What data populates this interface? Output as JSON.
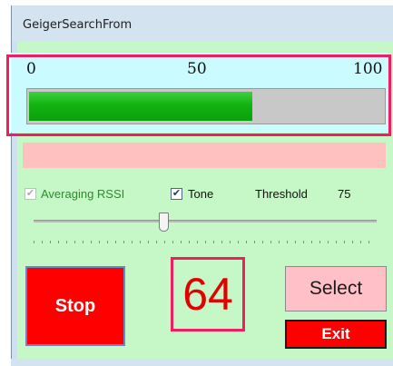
{
  "window": {
    "title": "GeigerSearchFrom"
  },
  "scale": {
    "min_label": "0",
    "mid_label": "50",
    "max_label": "100"
  },
  "progress": {
    "value": 63,
    "max": 100
  },
  "options": {
    "averaging_label": "Averaging RSSI",
    "averaging_checked": true,
    "tone_label": "Tone",
    "tone_checked": true,
    "threshold_label": "Threshold",
    "threshold_value": "75"
  },
  "slider": {
    "value": 0.38
  },
  "count": "64",
  "buttons": {
    "stop": "Stop",
    "select": "Select",
    "exit": "Exit"
  },
  "colors": {
    "client_bg": "#c6f7c6",
    "scale_bg": "#c9fbff",
    "progress_fill": "#12b312",
    "status_bar": "#ffc0c0",
    "stop": "#ff0000",
    "select": "#ffc0c8",
    "exit": "#ff0000",
    "count_text": "#e30000",
    "highlight": "#ee1e63"
  }
}
